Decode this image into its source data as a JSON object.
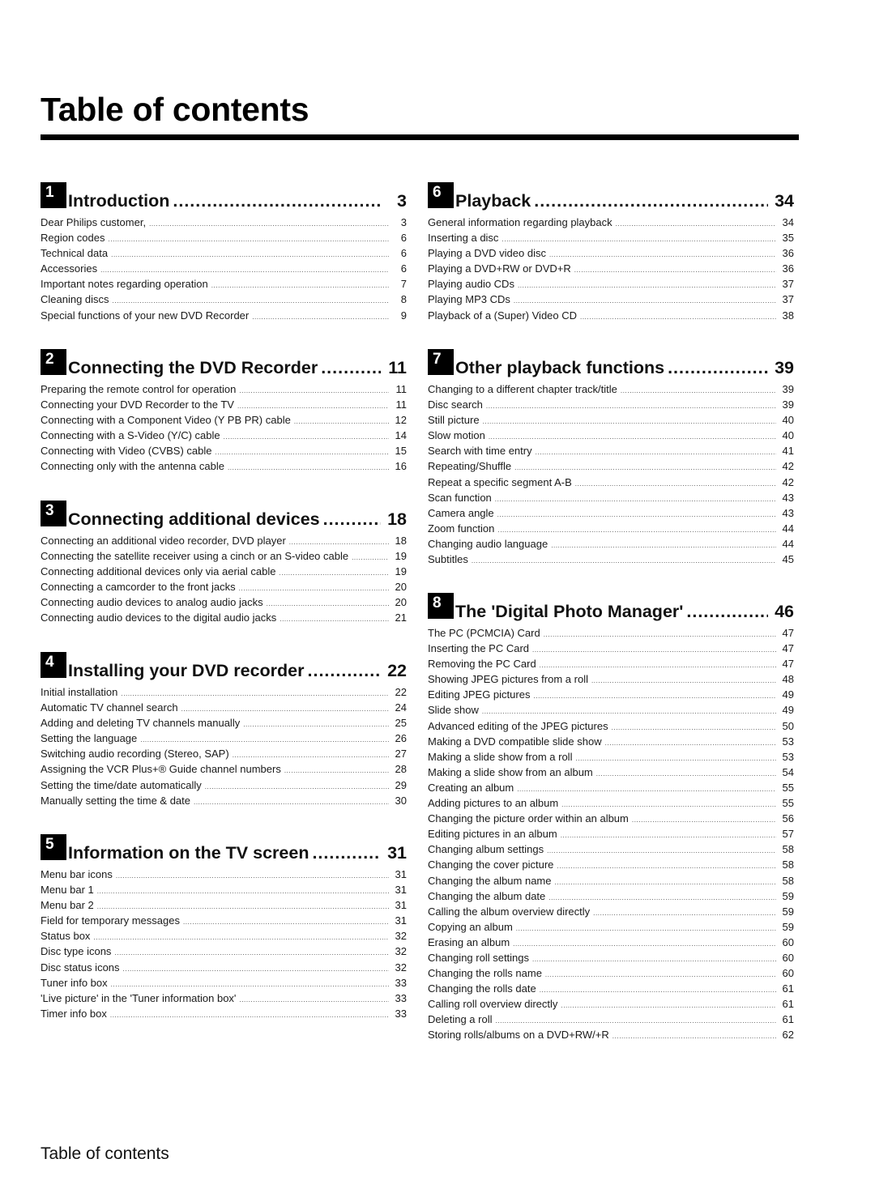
{
  "header": {
    "title": "Table of contents"
  },
  "footer": {
    "title": "Table of contents"
  },
  "sections": [
    {
      "number": "1",
      "title": "Introduction",
      "page": "3",
      "entries": [
        {
          "title": "Dear Philips customer,",
          "page": "3"
        },
        {
          "title": "Region codes",
          "page": "6"
        },
        {
          "title": "Technical data",
          "page": "6"
        },
        {
          "title": "Accessories",
          "page": "6"
        },
        {
          "title": "Important notes regarding operation",
          "page": "7"
        },
        {
          "title": "Cleaning discs",
          "page": "8"
        },
        {
          "title": "Special functions of your  new DVD Recorder",
          "page": "9"
        }
      ]
    },
    {
      "number": "2",
      "title": "Connecting the DVD Recorder",
      "page": "11",
      "entries": [
        {
          "title": "Preparing the remote control for operation",
          "page": "11"
        },
        {
          "title": "Connecting your DVD Recorder to the TV",
          "page": "11"
        },
        {
          "title": "Connecting with a Component Video (Y PB PR) cable",
          "page": "12"
        },
        {
          "title": "Connecting with a S-Video (Y/C) cable",
          "page": "14"
        },
        {
          "title": "Connecting with Video (CVBS) cable",
          "page": "15"
        },
        {
          "title": "Connecting only with the antenna cable",
          "page": "16"
        }
      ]
    },
    {
      "number": "3",
      "title": "Connecting additional devices",
      "page": "18",
      "entries": [
        {
          "title": "Connecting an additional video recorder, DVD player",
          "page": "18"
        },
        {
          "title": "Connecting the satellite receiver using a cinch or an S-video cable",
          "page": "19"
        },
        {
          "title": "Connecting additional devices only via aerial cable",
          "page": "19"
        },
        {
          "title": "Connecting a camcorder to the front jacks",
          "page": "20"
        },
        {
          "title": "Connecting audio devices to analog audio jacks",
          "page": "20"
        },
        {
          "title": "Connecting audio devices to the digital audio jacks",
          "page": "21"
        }
      ]
    },
    {
      "number": "4",
      "title": "Installing your DVD recorder",
      "page": "22",
      "entries": [
        {
          "title": "Initial installation",
          "page": "22"
        },
        {
          "title": "Automatic TV channel search",
          "page": "24"
        },
        {
          "title": "Adding and deleting TV channels manually",
          "page": "25"
        },
        {
          "title": "Setting the language",
          "page": "26"
        },
        {
          "title": "Switching audio recording (Stereo, SAP)",
          "page": "27"
        },
        {
          "title": "Assigning the VCR Plus+® Guide channel numbers",
          "page": "28"
        },
        {
          "title": "Setting the time/date automatically",
          "page": "29"
        },
        {
          "title": "Manually setting the time & date",
          "page": "30"
        }
      ]
    },
    {
      "number": "5",
      "title": "Information on the TV screen",
      "page": "31",
      "entries": [
        {
          "title": "Menu bar icons",
          "page": "31"
        },
        {
          "title": "Menu bar 1",
          "page": "31"
        },
        {
          "title": "Menu bar 2",
          "page": "31"
        },
        {
          "title": "Field for temporary messages",
          "page": "31"
        },
        {
          "title": "Status box",
          "page": "32"
        },
        {
          "title": "Disc type icons",
          "page": "32"
        },
        {
          "title": "Disc status icons",
          "page": "32"
        },
        {
          "title": "Tuner info box",
          "page": "33"
        },
        {
          "title": "'Live picture' in the 'Tuner information box'",
          "page": "33"
        },
        {
          "title": "Timer info box",
          "page": "33"
        }
      ]
    },
    {
      "number": "6",
      "title": "Playback",
      "page": "34",
      "entries": [
        {
          "title": "General information regarding playback",
          "page": "34"
        },
        {
          "title": "Inserting a disc",
          "page": "35"
        },
        {
          "title": "Playing a DVD video disc",
          "page": "36"
        },
        {
          "title": "Playing a DVD+RW or DVD+R",
          "page": "36"
        },
        {
          "title": "Playing audio CDs",
          "page": "37"
        },
        {
          "title": "Playing MP3 CDs",
          "page": "37"
        },
        {
          "title": "Playback of a (Super) Video CD",
          "page": "38"
        }
      ]
    },
    {
      "number": "7",
      "title": "Other playback functions",
      "page": "39",
      "entries": [
        {
          "title": "Changing to a different chapter track/title",
          "page": "39"
        },
        {
          "title": "Disc search",
          "page": "39"
        },
        {
          "title": "Still picture",
          "page": "40"
        },
        {
          "title": "Slow motion",
          "page": "40"
        },
        {
          "title": "Search with time entry",
          "page": "41"
        },
        {
          "title": "Repeating/Shuffle",
          "page": "42"
        },
        {
          "title": "Repeat a specific segment A-B",
          "page": "42"
        },
        {
          "title": "Scan function",
          "page": "43"
        },
        {
          "title": "Camera angle",
          "page": "43"
        },
        {
          "title": "Zoom function",
          "page": "44"
        },
        {
          "title": "Changing audio language",
          "page": "44"
        },
        {
          "title": "Subtitles",
          "page": "45"
        }
      ]
    },
    {
      "number": "8",
      "title": "The 'Digital Photo Manager'",
      "page": "46",
      "entries": [
        {
          "title": "The PC (PCMCIA) Card",
          "page": "47"
        },
        {
          "title": "Inserting the PC Card",
          "page": "47"
        },
        {
          "title": "Removing the PC Card",
          "page": "47"
        },
        {
          "title": "Showing JPEG pictures from a roll",
          "page": "48"
        },
        {
          "title": "Editing JPEG pictures",
          "page": "49"
        },
        {
          "title": "Slide show",
          "page": "49"
        },
        {
          "title": "Advanced editing of the JPEG pictures",
          "page": "50"
        },
        {
          "title": "Making a DVD compatible slide show",
          "page": "53"
        },
        {
          "title": "Making a slide show from a roll",
          "page": "53"
        },
        {
          "title": "Making a slide show from an album",
          "page": "54"
        },
        {
          "title": "Creating an album",
          "page": "55"
        },
        {
          "title": "Adding pictures to an album",
          "page": "55"
        },
        {
          "title": "Changing the picture order within an album",
          "page": "56"
        },
        {
          "title": "Editing pictures in an album",
          "page": "57"
        },
        {
          "title": "Changing album settings",
          "page": "58"
        },
        {
          "title": "Changing the cover picture",
          "page": "58"
        },
        {
          "title": "Changing the album name",
          "page": "58"
        },
        {
          "title": "Changing the album date",
          "page": "59"
        },
        {
          "title": "Calling the album overview directly",
          "page": "59"
        },
        {
          "title": "Copying an album",
          "page": "59"
        },
        {
          "title": "Erasing an album",
          "page": "60"
        },
        {
          "title": "Changing roll settings",
          "page": "60"
        },
        {
          "title": "Changing the rolls name",
          "page": "60"
        },
        {
          "title": "Changing the rolls date",
          "page": "61"
        },
        {
          "title": "Calling roll overview directly",
          "page": "61"
        },
        {
          "title": "Deleting a roll",
          "page": "61"
        },
        {
          "title": "Storing rolls/albums on a DVD+RW/+R",
          "page": "62"
        }
      ]
    }
  ]
}
